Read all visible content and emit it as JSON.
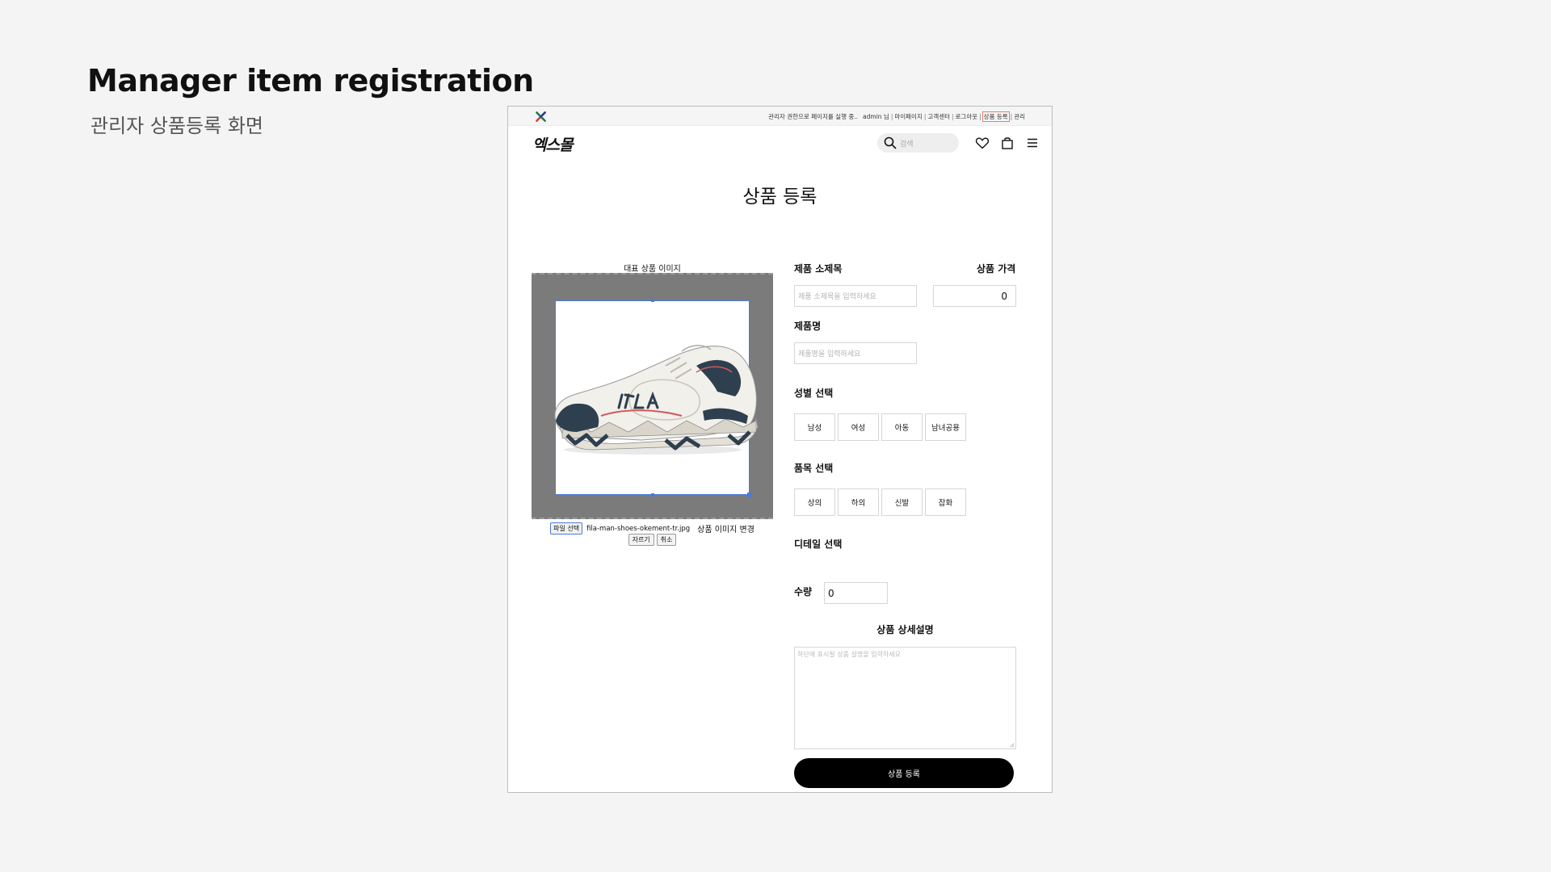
{
  "slide": {
    "title": "Manager item registration",
    "subtitle": "관리자 상품등록 화면"
  },
  "topbar": {
    "admin_notice": "관리자 권한으로 페이지를 실행 중..",
    "user": "admin 님",
    "links": [
      "마이페이지",
      "고객센터",
      "로그아웃",
      "상품 등록",
      "관리"
    ]
  },
  "header": {
    "brand": "엑스몰",
    "search_placeholder": "검색"
  },
  "page": {
    "title": "상품 등록"
  },
  "image_section": {
    "label": "대표 상품 이미지",
    "file_button": "파일 선택",
    "file_name": "fila-man-shoes-okement-tr.jpg",
    "change_label": "상품 이미지 변경",
    "crop_button": "자르기",
    "cancel_button": "취소"
  },
  "form": {
    "subtitle_label": "제품 소제목",
    "subtitle_placeholder": "제품 소제목을 입력하세요",
    "price_label": "상품 가격",
    "price_value": "0",
    "name_label": "제품명",
    "name_placeholder": "제품명을 입력하세요",
    "gender_label": "성별 선택",
    "gender_options": [
      "남성",
      "여성",
      "아동",
      "남녀공용"
    ],
    "category_label": "품목 선택",
    "category_options": [
      "상의",
      "하의",
      "신발",
      "잡화"
    ],
    "detail_label": "디테일 선택",
    "quantity_label": "수량",
    "quantity_value": "0",
    "description_label": "상품 상세설명",
    "description_placeholder": "하단에 표시될 상품 설명을 입력하세요",
    "submit_label": "상품 등록"
  },
  "icons": {
    "logo": "x-logo-icon",
    "search": "search-icon",
    "wishlist": "heart-icon",
    "cart": "shopping-bag-icon",
    "menu": "hamburger-menu-icon"
  }
}
